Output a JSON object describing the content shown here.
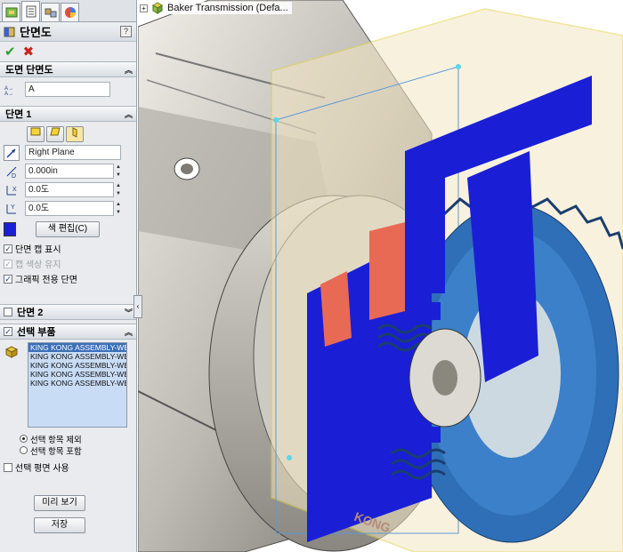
{
  "panel": {
    "title": "단면도",
    "help": "?",
    "groups": {
      "section_view": {
        "label": "도면 단면도",
        "name_value": "A"
      },
      "section1": {
        "label": "단면 1",
        "plane_value": "Right Plane",
        "offset_value": "0.000in",
        "angle_x_value": "0.0도",
        "angle_y_value": "0.0도",
        "edit_color_label": "색 편집(C)",
        "section_color": "#1a1fd6",
        "checkboxes": [
          {
            "label": "단면 캡 표시",
            "checked": true,
            "enabled": true
          },
          {
            "label": "캡 색상 유지",
            "checked": true,
            "enabled": false
          },
          {
            "label": "그래픽 전용 단면",
            "checked": true,
            "enabled": true
          }
        ]
      },
      "section2": {
        "label": "단면 2"
      },
      "selected_components": {
        "label": "선택 부품",
        "items": [
          "KING KONG ASSEMBLY-WE",
          "KING KONG ASSEMBLY-WE",
          "KING KONG ASSEMBLY-WE",
          "KING KONG ASSEMBLY-WE",
          "KING KONG ASSEMBLY-WE"
        ],
        "radio_exclude": "선택 항목 제외",
        "radio_include": "선택 항목 포함",
        "use_plane": "선택 평면 사용"
      }
    },
    "preview_label": "미리 보기",
    "save_label": "저장"
  },
  "viewport": {
    "tree_item": "Baker Transmission  (Defa...",
    "model_text": "KONG"
  }
}
